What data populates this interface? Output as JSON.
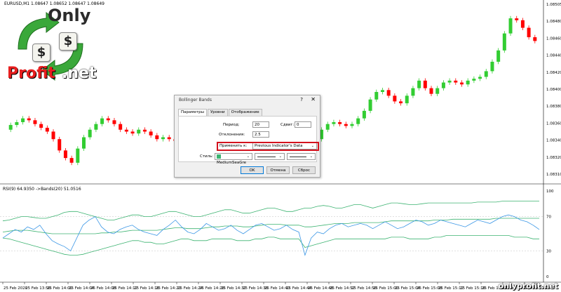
{
  "chart_header": {
    "symbol_info": "EURUSD,M1  1.08647 1.08652 1.08647 1.08649"
  },
  "indicator_header": {
    "info": "RSI(9) 64.9350  ->Bands(20) 51.0516"
  },
  "price_axis": {
    "ticks": [
      "1.08505",
      "1.08480",
      "1.08460",
      "1.08440",
      "1.08420",
      "1.08400",
      "1.08380",
      "1.08360",
      "1.08340",
      "1.08320",
      "1.08310"
    ]
  },
  "indicator_axis": {
    "ticks": [
      "100",
      "70",
      "30",
      "0"
    ]
  },
  "time_axis": {
    "ticks": [
      "25 Feb 2020",
      "25 Feb 13:56",
      "25 Feb 14:00",
      "25 Feb 14:04",
      "25 Feb 14:08",
      "25 Feb 14:12",
      "25 Feb 14:16",
      "25 Feb 14:20",
      "25 Feb 14:24",
      "25 Feb 14:28",
      "25 Feb 14:32",
      "25 Feb 14:36",
      "25 Feb 14:40",
      "25 Feb 14:44",
      "25 Feb 14:48",
      "25 Feb 14:52",
      "25 Feb 14:56",
      "25 Feb 15:00",
      "25 Feb 15:04",
      "25 Feb 15:08",
      "25 Feb 15:12",
      "25 Feb 15:16",
      "25 Feb 15:20",
      "25 Feb 15:24",
      "25 Feb 15:28"
    ]
  },
  "logo": {
    "top_text": "Only",
    "bottom_left": "Profit",
    "bottom_right": ".net",
    "symbol": "$"
  },
  "watermark": "onlyprofit.net",
  "dialog": {
    "title": "Bollinger Bands",
    "help": "?",
    "close": "✕",
    "tabs": [
      {
        "label": "Параметры",
        "active": true
      },
      {
        "label": "Уровни",
        "active": false
      },
      {
        "label": "Отображение",
        "active": false
      }
    ],
    "period_label": "Период:",
    "period_value": "20",
    "shift_label": "Сдвиг:",
    "shift_value": "0",
    "deviation_label": "Отклонения:",
    "deviation_value": "2.5",
    "apply_label": "Применить к:",
    "apply_value": "Previous Indicator's Data",
    "style_label": "Стиль:",
    "style_color": "MediumSeaGre",
    "buttons": {
      "ok": "OK",
      "cancel": "Отмена",
      "reset": "Сброс"
    }
  },
  "colors": {
    "bull": "#32cd32",
    "bear": "#ff0000",
    "rsi_line": "#3b97e6",
    "bands_line": "#3cb371",
    "highlight": "#d3121e"
  },
  "chart_data": {
    "type": "candlestick",
    "price_series": [
      1.0836,
      1.08365,
      1.08368,
      1.08372,
      1.0837,
      1.08366,
      1.08362,
      1.08358,
      1.0835,
      1.08338,
      1.0833,
      1.08325,
      1.0834,
      1.08352,
      1.0836,
      1.08366,
      1.08372,
      1.0837,
      1.08366,
      1.0836,
      1.08358,
      1.08356,
      1.0836,
      1.08358,
      1.08354,
      1.0835,
      1.08352,
      1.0835,
      1.08348,
      1.08346,
      1.08348,
      1.0835,
      1.08352,
      1.08354,
      1.08352,
      1.0835,
      1.08352,
      1.08354,
      1.08352,
      1.0835,
      1.08352,
      1.08358,
      1.08362,
      1.0836,
      1.08356,
      1.0836,
      1.08362,
      1.0836,
      1.08356,
      1.08326,
      1.0834,
      1.0835,
      1.0836,
      1.08366,
      1.08368,
      1.08366,
      1.08364,
      1.08366,
      1.08372,
      1.0838,
      1.08392,
      1.084,
      1.08402,
      1.08396,
      1.0839,
      1.08388,
      1.08396,
      1.08404,
      1.08412,
      1.08404,
      1.08398,
      1.08404,
      1.0841,
      1.08412,
      1.0841,
      1.08408,
      1.08412,
      1.08414,
      1.08416,
      1.08422,
      1.08432,
      1.08444,
      1.08462,
      1.08478,
      1.08476,
      1.08468,
      1.08458,
      1.08454
    ],
    "rsi_series": [
      45,
      50,
      55,
      52,
      58,
      55,
      60,
      50,
      42,
      38,
      35,
      30,
      45,
      60,
      66,
      70,
      58,
      52,
      50,
      55,
      58,
      60,
      55,
      52,
      50,
      48,
      55,
      60,
      66,
      58,
      52,
      50,
      55,
      62,
      58,
      54,
      56,
      60,
      54,
      50,
      55,
      60,
      62,
      58,
      54,
      56,
      60,
      55,
      52,
      25,
      45,
      52,
      50,
      56,
      60,
      62,
      58,
      60,
      62,
      60,
      56,
      60,
      64,
      60,
      56,
      58,
      62,
      66,
      64,
      60,
      62,
      66,
      64,
      62,
      60,
      58,
      62,
      66,
      64,
      62,
      66,
      70,
      72,
      70,
      66,
      64,
      60,
      55
    ],
    "upper_band": [
      65,
      66,
      68,
      70,
      70,
      69,
      68,
      68,
      70,
      72,
      75,
      76,
      76,
      74,
      72,
      70,
      68,
      66,
      66,
      68,
      70,
      72,
      72,
      70,
      70,
      72,
      74,
      76,
      76,
      74,
      72,
      70,
      70,
      72,
      74,
      76,
      78,
      78,
      76,
      74,
      74,
      76,
      78,
      80,
      80,
      78,
      76,
      76,
      78,
      80,
      80,
      82,
      83,
      82,
      80,
      80,
      82,
      84,
      84,
      82,
      80,
      82,
      84,
      86,
      86,
      85,
      84,
      84,
      85,
      86,
      86,
      86,
      86,
      86,
      86,
      86,
      86,
      87,
      87,
      87,
      87,
      88,
      88,
      88,
      88,
      88,
      88,
      88
    ],
    "lower_band": [
      45,
      44,
      42,
      40,
      38,
      36,
      34,
      32,
      30,
      28,
      26,
      25,
      25,
      26,
      28,
      30,
      32,
      34,
      36,
      38,
      40,
      42,
      42,
      40,
      40,
      38,
      38,
      40,
      42,
      44,
      44,
      42,
      42,
      42,
      44,
      44,
      44,
      44,
      42,
      42,
      42,
      44,
      44,
      46,
      46,
      44,
      44,
      44,
      44,
      34,
      36,
      38,
      40,
      42,
      44,
      44,
      44,
      44,
      44,
      44,
      44,
      44,
      44,
      46,
      46,
      46,
      44,
      44,
      44,
      44,
      46,
      46,
      48,
      48,
      48,
      48,
      48,
      48,
      48,
      48,
      48,
      48,
      48,
      46,
      46,
      46,
      44,
      44
    ],
    "middle_band": [
      52,
      53,
      54,
      54,
      54,
      53,
      52,
      51,
      50,
      50,
      50,
      50,
      50,
      50,
      50,
      50,
      51,
      51,
      52,
      52,
      53,
      54,
      54,
      54,
      54,
      54,
      55,
      56,
      57,
      57,
      56,
      56,
      56,
      57,
      58,
      58,
      59,
      59,
      59,
      58,
      58,
      59,
      60,
      61,
      61,
      61,
      60,
      60,
      60,
      58,
      58,
      59,
      60,
      61,
      62,
      62,
      62,
      63,
      63,
      63,
      63,
      63,
      64,
      65,
      65,
      65,
      65,
      65,
      65,
      65,
      66,
      66,
      66,
      67,
      67,
      67,
      67,
      67,
      67,
      67,
      68,
      68,
      68,
      68,
      68,
      68,
      68,
      68
    ],
    "rsi_levels": [
      70,
      30
    ],
    "ylim": [
      0,
      100
    ]
  }
}
